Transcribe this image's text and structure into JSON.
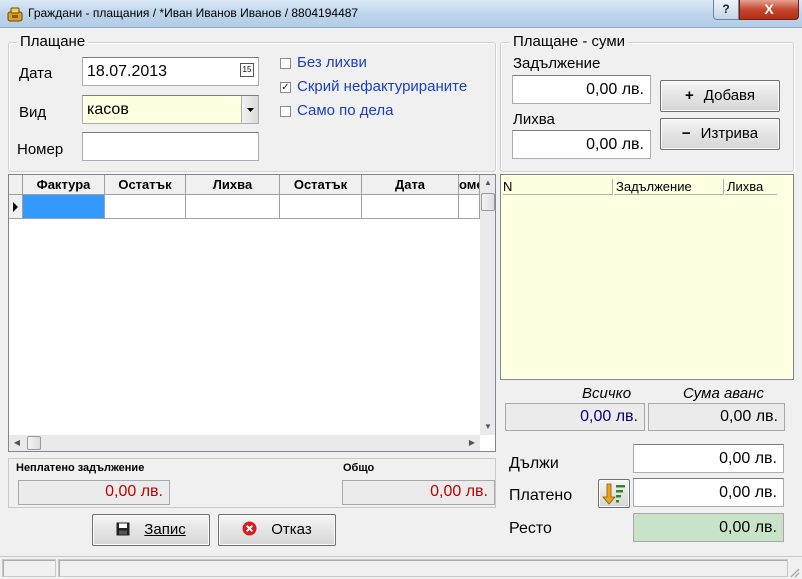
{
  "window": {
    "title": "Граждани - плащания / *Иван Иванов Иванов / 8804194487",
    "help_label": "?",
    "close_label": "X"
  },
  "payment": {
    "group_title": "Плащане",
    "date_label": "Дата",
    "date_value": "18.07.2013",
    "calendar_icon_text": "15",
    "type_label": "Вид",
    "type_value": "касов",
    "number_label": "Номер",
    "number_value": ""
  },
  "options": {
    "no_interest": {
      "label": "Без лихви",
      "checked": false
    },
    "hide_uninvoiced": {
      "label": "Скрий нефактурираните",
      "checked": true
    },
    "cases_only": {
      "label": "Само по дела",
      "checked": false
    }
  },
  "invoices_grid": {
    "columns": [
      "Фактура",
      "Остатък",
      "Лихва",
      "Остатък",
      "Дата",
      "оме"
    ],
    "rows": [
      [
        "",
        "",
        "",
        "",
        "",
        ""
      ]
    ]
  },
  "totals_left": {
    "unpaid_label": "Неплатено задължение",
    "unpaid_value": "0,00 лв.",
    "total_label": "Общо",
    "total_value": "0,00 лв."
  },
  "actions": {
    "save_label": "Запис",
    "cancel_label": "Отказ"
  },
  "sums": {
    "group_title": "Плащане - суми",
    "liability_label": "Задължение",
    "liability_value": "0,00 лв.",
    "interest_label": "Лихва",
    "interest_value": "0,00 лв.",
    "add_label": "Добавя",
    "delete_label": "Изтрива"
  },
  "sums_grid": {
    "columns": [
      "N",
      "Задължение",
      "Лихва"
    ]
  },
  "summary": {
    "all_label": "Всичко",
    "all_value": "0,00 лв.",
    "advance_label": "Сума аванс",
    "advance_value": "0,00 лв.",
    "owes_label": "Дължи",
    "owes_value": "0,00 лв.",
    "paid_label": "Платено",
    "paid_value": "0,00 лв.",
    "change_label": "Ресто",
    "change_value": "0,00 лв."
  },
  "colors": {
    "red_value": "#c00000",
    "blue_value": "#00007a",
    "link_label": "#1a3fbf",
    "type_field_bg": "#ffffe1",
    "sums_grid_bg": "#ffffe1",
    "change_field_bg": "#c9e3c9",
    "selected_cell": "#3399ff"
  }
}
